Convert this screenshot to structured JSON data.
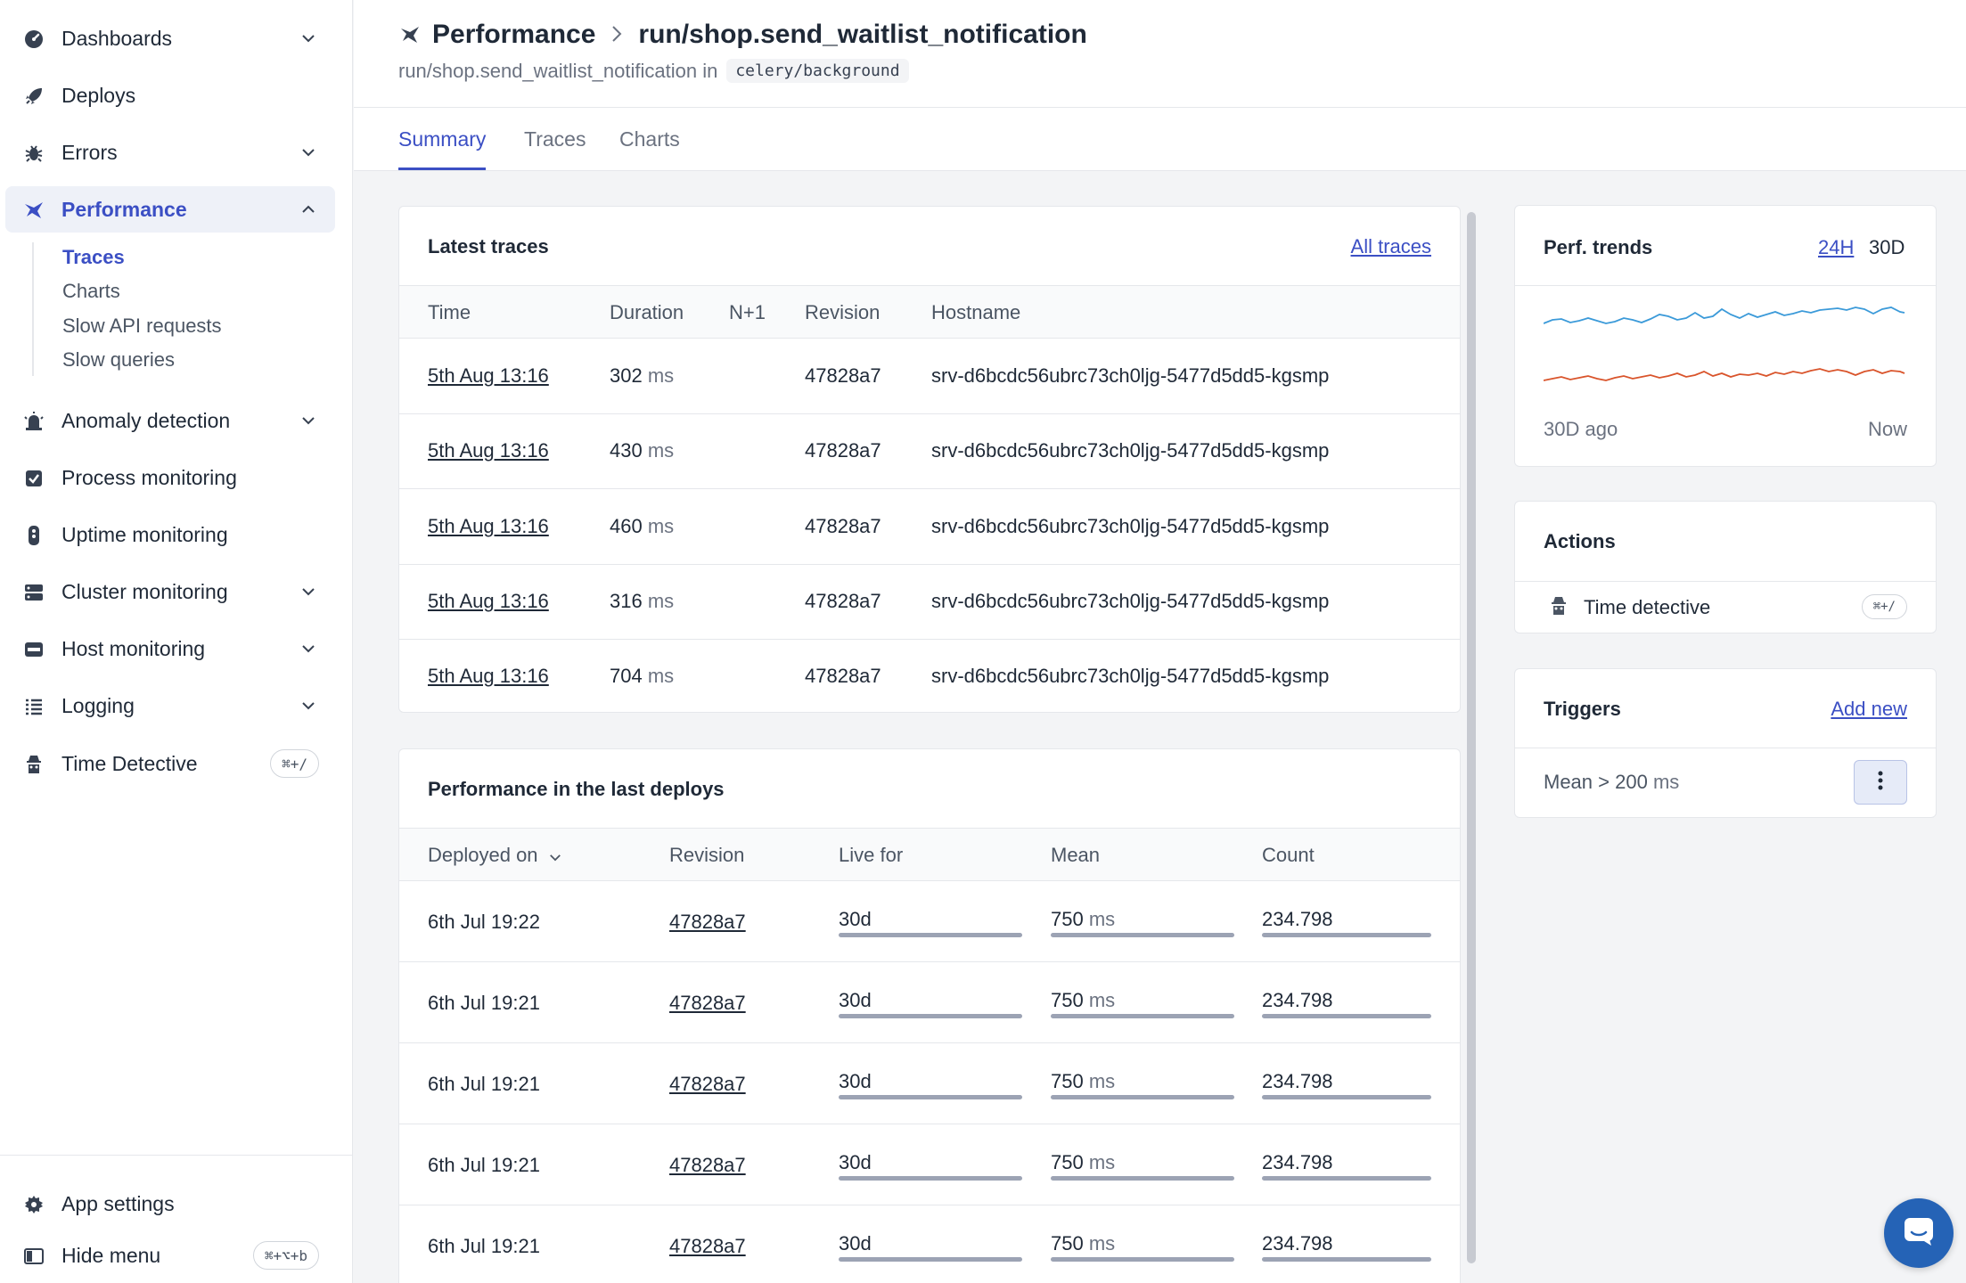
{
  "sidebar": {
    "items": [
      {
        "label": "Dashboards",
        "icon": "dashboard-icon"
      },
      {
        "label": "Deploys",
        "icon": "rocket-icon"
      },
      {
        "label": "Errors",
        "icon": "bug-icon"
      },
      {
        "label": "Performance",
        "icon": "performance-icon"
      },
      {
        "label": "Anomaly detection",
        "icon": "alarm-icon"
      },
      {
        "label": "Process monitoring",
        "icon": "checkbox-icon"
      },
      {
        "label": "Uptime monitoring",
        "icon": "status-icon"
      },
      {
        "label": "Cluster monitoring",
        "icon": "server-icon"
      },
      {
        "label": "Host monitoring",
        "icon": "host-icon"
      },
      {
        "label": "Logging",
        "icon": "list-icon"
      },
      {
        "label": "Time Detective",
        "icon": "detective-icon",
        "shortcut": "⌘+/"
      }
    ],
    "subitems": [
      "Traces",
      "Charts",
      "Slow API requests",
      "Slow queries"
    ],
    "bottom": [
      {
        "label": "App settings",
        "icon": "gear-icon"
      },
      {
        "label": "Hide menu",
        "icon": "sidebar-icon",
        "shortcut": "⌘+⌥+b"
      }
    ]
  },
  "header": {
    "section": "Performance",
    "title": "run/shop.send_waitlist_notification",
    "subtitle_text": "run/shop.send_waitlist_notification in",
    "namespace": "celery/background"
  },
  "tabs": [
    "Summary",
    "Traces",
    "Charts"
  ],
  "latest_traces": {
    "title": "Latest traces",
    "link": "All traces",
    "columns": [
      "Time",
      "Duration",
      "N+1",
      "Revision",
      "Hostname"
    ],
    "unit": "ms",
    "rows": [
      {
        "time": "5th Aug 13:16",
        "duration": "302",
        "revision": "47828a7",
        "hostname": "srv-d6bcdc56ubrc73ch0ljg-5477d5dd5-kgsmp"
      },
      {
        "time": "5th Aug 13:16",
        "duration": "430",
        "revision": "47828a7",
        "hostname": "srv-d6bcdc56ubrc73ch0ljg-5477d5dd5-kgsmp"
      },
      {
        "time": "5th Aug 13:16",
        "duration": "460",
        "revision": "47828a7",
        "hostname": "srv-d6bcdc56ubrc73ch0ljg-5477d5dd5-kgsmp"
      },
      {
        "time": "5th Aug 13:16",
        "duration": "316",
        "revision": "47828a7",
        "hostname": "srv-d6bcdc56ubrc73ch0ljg-5477d5dd5-kgsmp"
      },
      {
        "time": "5th Aug 13:16",
        "duration": "704",
        "revision": "47828a7",
        "hostname": "srv-d6bcdc56ubrc73ch0ljg-5477d5dd5-kgsmp"
      }
    ]
  },
  "deploys": {
    "title": "Performance in the last deploys",
    "columns": [
      "Deployed on",
      "Revision",
      "Live for",
      "Mean",
      "Count"
    ],
    "unit": "ms",
    "rows": [
      {
        "deployed_on": "6th Jul 19:22",
        "revision": "47828a7",
        "live_for": "30d",
        "mean": "750",
        "count": "234.798"
      },
      {
        "deployed_on": "6th Jul 19:21",
        "revision": "47828a7",
        "live_for": "30d",
        "mean": "750",
        "count": "234.798"
      },
      {
        "deployed_on": "6th Jul 19:21",
        "revision": "47828a7",
        "live_for": "30d",
        "mean": "750",
        "count": "234.798"
      },
      {
        "deployed_on": "6th Jul 19:21",
        "revision": "47828a7",
        "live_for": "30d",
        "mean": "750",
        "count": "234.798"
      },
      {
        "deployed_on": "6th Jul 19:21",
        "revision": "47828a7",
        "live_for": "30d",
        "mean": "750",
        "count": "234.798"
      }
    ]
  },
  "perf_trends": {
    "title": "Perf. trends",
    "range_options": [
      "24H",
      "30D"
    ],
    "selected_range": "30D",
    "start_label": "30D ago",
    "end_label": "Now",
    "colors": {
      "series_a": "#3b9ad9",
      "series_b": "#d9542b"
    }
  },
  "actions": {
    "title": "Actions",
    "items": [
      {
        "label": "Time detective",
        "icon": "detective-icon",
        "shortcut": "⌘+/"
      }
    ]
  },
  "triggers": {
    "title": "Triggers",
    "link": "Add new",
    "items": [
      {
        "label": "Mean > 200",
        "unit": "ms"
      }
    ]
  },
  "colors": {
    "accent": "#3b4fc4",
    "chat_button": "#2563b6"
  }
}
